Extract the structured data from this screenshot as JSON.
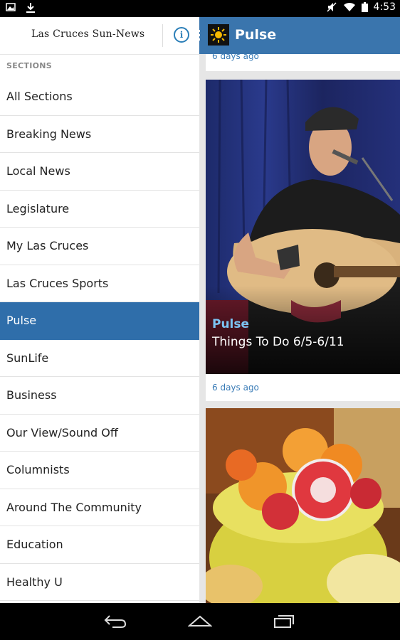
{
  "status": {
    "time": "4:53"
  },
  "drawer": {
    "logo": "Las Cruces Sun-News",
    "info_label": "i",
    "sections_heading": "SECTIONS",
    "items": [
      {
        "label": "All Sections"
      },
      {
        "label": "Breaking News"
      },
      {
        "label": "Local News"
      },
      {
        "label": "Legislature"
      },
      {
        "label": "My Las Cruces"
      },
      {
        "label": "Las Cruces Sports"
      },
      {
        "label": "Pulse",
        "active": true
      },
      {
        "label": "SunLife"
      },
      {
        "label": "Business"
      },
      {
        "label": "Our View/Sound Off"
      },
      {
        "label": "Columnists"
      },
      {
        "label": "Around The Community"
      },
      {
        "label": "Education"
      },
      {
        "label": "Healthy U"
      }
    ]
  },
  "appbar": {
    "title": "Pulse",
    "accent": "#3a75ad"
  },
  "feed": {
    "top_card": {
      "time_ago": "6 days ago"
    },
    "card": {
      "category": "Pulse",
      "headline": "Things To Do 6/5-6/11",
      "time_ago": "6 days ago"
    }
  },
  "colors": {
    "active_item": "#2f6eaa",
    "link_blue": "#3a7cb7",
    "category_blue": "#7cc3f2"
  }
}
